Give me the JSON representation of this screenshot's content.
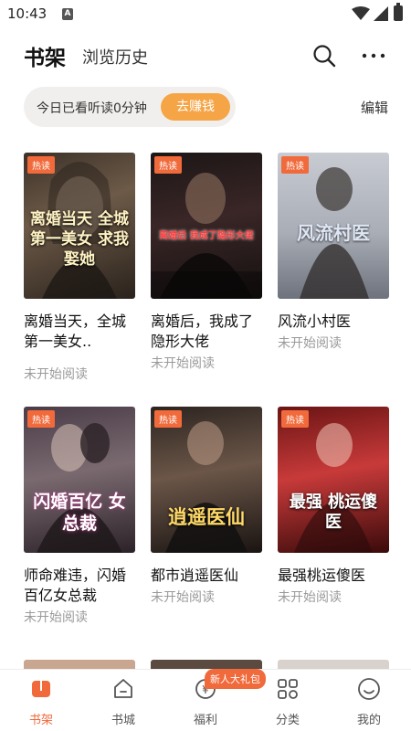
{
  "status_bar": {
    "time": "10:43",
    "a_label": "A"
  },
  "header": {
    "tab_bookshelf": "书架",
    "tab_history": "浏览历史",
    "search_icon": "search-icon",
    "more_icon": "more-icon"
  },
  "reading": {
    "text": "今日已看听读0分钟",
    "earn_label": "去赚钱",
    "edit_label": "编辑"
  },
  "books": [
    {
      "hot": "热读",
      "title": "离婚当天，全城第一美女..",
      "status": "未开始阅读",
      "cover_text": "离婚当天 全城第一美女 求我娶她",
      "accent": "#5a4a3c"
    },
    {
      "hot": "热读",
      "title": "离婚后，我成了隐形大佬",
      "status": "未开始阅读",
      "cover_text": "离婚后 我成了隐形大佬",
      "accent": "#7a1f1f"
    },
    {
      "hot": "热读",
      "title": "风流小村医",
      "status": "未开始阅读",
      "cover_text": "风流村医",
      "accent": "#8a8c94"
    },
    {
      "hot": "热读",
      "title": "师命难违，闪婚百亿女总裁",
      "status": "未开始阅读",
      "cover_text": "闪婚百亿 女总裁",
      "accent": "#3a2f3a"
    },
    {
      "hot": "热读",
      "title": "都市逍遥医仙",
      "status": "未开始阅读",
      "cover_text": "逍遥医仙",
      "accent": "#2b2320"
    },
    {
      "hot": "热读",
      "title": "最强桃运傻医",
      "status": "未开始阅读",
      "cover_text": "最强 桃运傻医",
      "accent": "#8a1d1d"
    }
  ],
  "bottom_nav": {
    "items": [
      {
        "label": "书架",
        "icon": "bookshelf-icon"
      },
      {
        "label": "书城",
        "icon": "bookstore-icon"
      },
      {
        "label": "福利",
        "icon": "welfare-icon"
      },
      {
        "label": "分类",
        "icon": "category-icon"
      },
      {
        "label": "我的",
        "icon": "profile-icon"
      }
    ],
    "gift_badge": "新人大礼包"
  },
  "colors": {
    "accent": "#f06a3b",
    "earn_button": "#f6a546"
  }
}
